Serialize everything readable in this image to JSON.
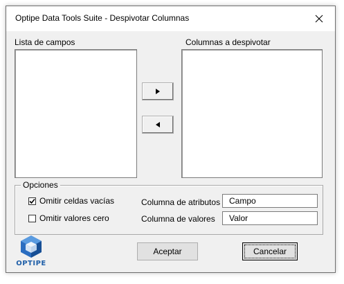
{
  "window": {
    "title": "Optipe Data Tools Suite - Despivotar Columnas"
  },
  "fields": {
    "left_label": "Lista de campos",
    "right_label": "Columnas a despivotar",
    "left_items": [],
    "right_items": []
  },
  "options": {
    "legend": "Opciones",
    "omit_empty_label": "Omitir celdas vacías",
    "omit_empty_checked": true,
    "omit_zero_label": "Omitir valores cero",
    "omit_zero_checked": false,
    "attr_column_label": "Columna de atributos",
    "attr_column_value": "Campo",
    "value_column_label": "Columna de valores",
    "value_column_value": "Valor"
  },
  "buttons": {
    "accept": "Aceptar",
    "cancel": "Cancelar"
  },
  "logo": {
    "text": "OPTIPE",
    "color": "#1f5fa8"
  },
  "icons": {
    "move_right": "triangle-right-icon",
    "move_left": "triangle-left-icon",
    "close": "close-icon"
  }
}
